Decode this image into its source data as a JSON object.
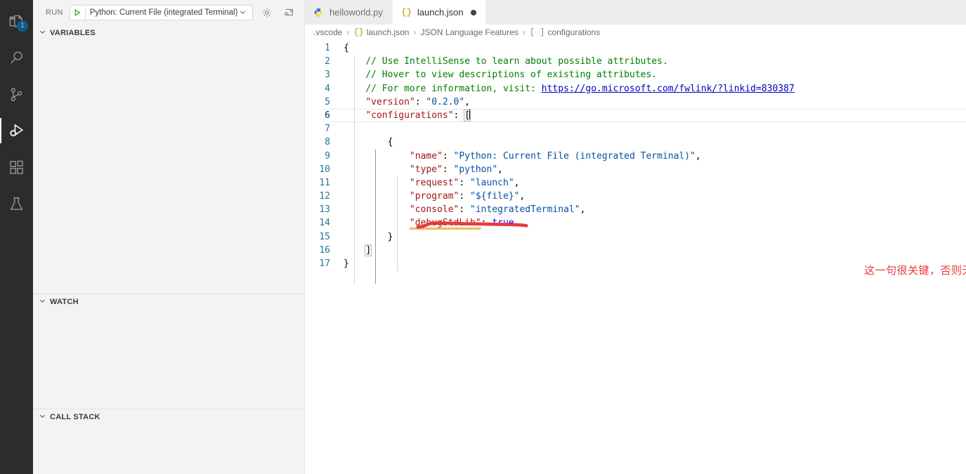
{
  "activitybar": {
    "items": [
      {
        "name": "explorer",
        "icon": "files-icon",
        "badge": "1",
        "active": false
      },
      {
        "name": "search",
        "icon": "search-icon",
        "badge": "",
        "active": false
      },
      {
        "name": "source-control",
        "icon": "source-control-icon",
        "badge": "",
        "active": false
      },
      {
        "name": "run-and-debug",
        "icon": "run-debug-icon",
        "badge": "",
        "active": true
      },
      {
        "name": "extensions",
        "icon": "extensions-icon",
        "badge": "",
        "active": false
      },
      {
        "name": "testing",
        "icon": "beaker-icon",
        "badge": "",
        "active": false
      }
    ]
  },
  "sidebar": {
    "toolbar": {
      "run_label": "RUN",
      "play_icon": "play-icon",
      "config_value": "Python: Current File (integrated Terminal)",
      "dropdown_icon": "chevron-down-icon",
      "gear_icon": "gear-icon",
      "open_debug_icon": "open-debug-console-icon"
    },
    "sections": [
      {
        "label": "VARIABLES",
        "chevron": "chevron-down-icon"
      },
      {
        "label": "WATCH",
        "chevron": "chevron-down-icon"
      },
      {
        "label": "CALL STACK",
        "chevron": "chevron-down-icon"
      }
    ]
  },
  "editor": {
    "tabs": [
      {
        "label": "helloworld.py",
        "icon": "python-file-icon",
        "active": false,
        "dirty": false
      },
      {
        "label": "launch.json",
        "icon": "json-file-icon",
        "active": true,
        "dirty": true
      }
    ],
    "breadcrumbs": [
      {
        "label": ".vscode",
        "icon": ""
      },
      {
        "label": "launch.json",
        "icon": "{}"
      },
      {
        "label": "JSON Language Features",
        "icon": ""
      },
      {
        "label": "configurations",
        "icon": "[ ]"
      }
    ],
    "separator": "›",
    "lines": [
      {
        "no": "1",
        "current": false
      },
      {
        "no": "2",
        "current": false
      },
      {
        "no": "3",
        "current": false
      },
      {
        "no": "4",
        "current": false
      },
      {
        "no": "5",
        "current": false
      },
      {
        "no": "6",
        "current": true
      },
      {
        "no": "7",
        "current": false
      },
      {
        "no": "8",
        "current": false
      },
      {
        "no": "9",
        "current": false
      },
      {
        "no": "10",
        "current": false
      },
      {
        "no": "11",
        "current": false
      },
      {
        "no": "12",
        "current": false
      },
      {
        "no": "13",
        "current": false
      },
      {
        "no": "14",
        "current": false
      },
      {
        "no": "15",
        "current": false
      },
      {
        "no": "16",
        "current": false
      },
      {
        "no": "17",
        "current": false
      }
    ],
    "code": {
      "l1_brace": "{",
      "l2_comment": "// Use IntelliSense to learn about possible attributes.",
      "l3_comment": "// Hover to view descriptions of existing attributes.",
      "l4_comment": "// For more information, visit: ",
      "l4_link": "https://go.microsoft.com/fwlink/?linkid=830387",
      "l5_key": "\"version\"",
      "l5_colon": ": ",
      "l5_value": "\"0.2.0\"",
      "l5_comma": ",",
      "l6_key": "\"configurations\"",
      "l6_colon": ": ",
      "l6_bracket": "[",
      "l8_brace": "{",
      "l9_key": "\"name\"",
      "l9_value": "\"Python: Current File (integrated Terminal)\"",
      "l10_key": "\"type\"",
      "l10_value": "\"python\"",
      "l11_key": "\"request\"",
      "l11_value": "\"launch\"",
      "l12_key": "\"program\"",
      "l12_value": "\"${file}\"",
      "l13_key": "\"console\"",
      "l13_value": "\"integratedTerminal\"",
      "l14_key": "\"debugStdLib\"",
      "l14_value": "true",
      "colon": ": ",
      "comma": ",",
      "l15_brace": "}",
      "l16_bracket": "]",
      "l17_brace": "}"
    }
  },
  "annotation": {
    "text": "这一句很关键，否则无法停在断点上",
    "color": "#e8393a",
    "underline_label": "hand-drawn-red-underline"
  },
  "colors": {
    "accent": "#007acc",
    "activitybar_bg": "#2c2c2c",
    "sidebar_bg": "#f3f3f3",
    "editor_bg": "#ffffff",
    "annotation_red": "#e8393a",
    "comment_green": "#008000",
    "string_red": "#a31515",
    "value_blue": "#0451a5"
  }
}
